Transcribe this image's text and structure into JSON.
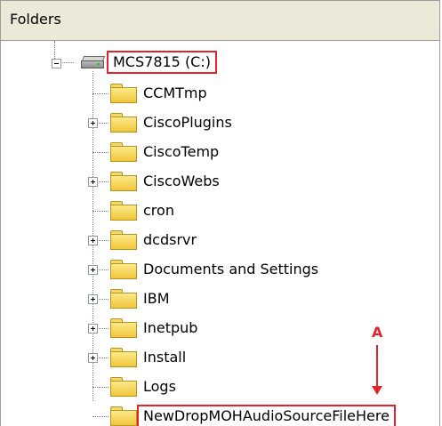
{
  "header": {
    "title": "Folders"
  },
  "drive": {
    "label": "MCS7815 (C:)",
    "highlighted": true,
    "expanded": true
  },
  "folders": [
    {
      "label": "CCMTmp",
      "expander": "none"
    },
    {
      "label": "CiscoPlugins",
      "expander": "plus"
    },
    {
      "label": "CiscoTemp",
      "expander": "none"
    },
    {
      "label": "CiscoWebs",
      "expander": "plus"
    },
    {
      "label": "cron",
      "expander": "none"
    },
    {
      "label": "dcdsrvr",
      "expander": "plus"
    },
    {
      "label": "Documents and Settings",
      "expander": "plus"
    },
    {
      "label": "IBM",
      "expander": "plus"
    },
    {
      "label": "Inetpub",
      "expander": "plus"
    },
    {
      "label": "Install",
      "expander": "plus"
    },
    {
      "label": "Logs",
      "expander": "none"
    },
    {
      "label": "NewDropMOHAudioSourceFileHere",
      "expander": "none",
      "highlighted": true
    }
  ],
  "annotation": {
    "label": "A",
    "color": "#e3242b"
  },
  "colors": {
    "header_bg": "#ece9d8",
    "highlight": "#e3242b",
    "folder": "#f5d76b"
  }
}
